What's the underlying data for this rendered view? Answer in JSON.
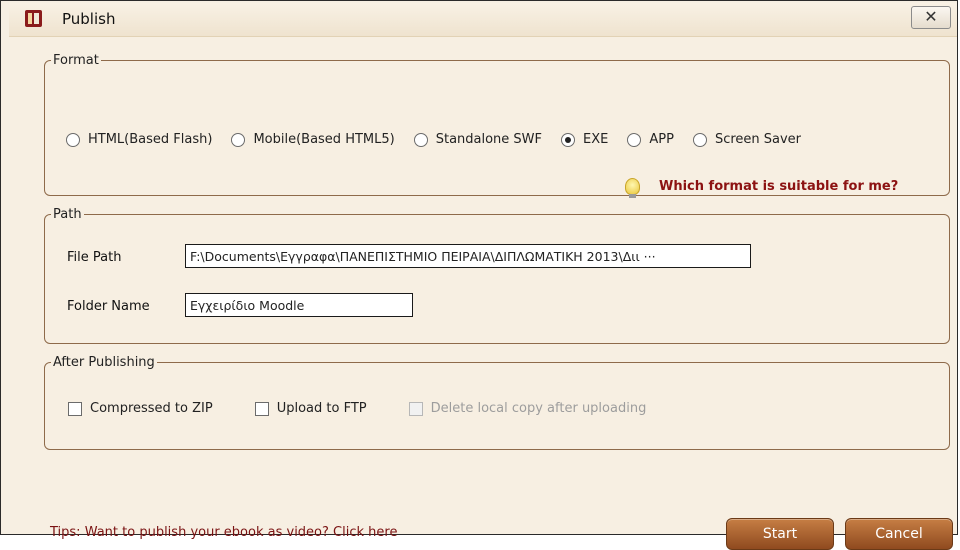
{
  "window": {
    "title": "Publish",
    "close_label": "✕"
  },
  "format": {
    "legend": "Format",
    "options": [
      {
        "label": "HTML(Based Flash)",
        "selected": false
      },
      {
        "label": "Mobile(Based HTML5)",
        "selected": false
      },
      {
        "label": "Standalone SWF",
        "selected": false
      },
      {
        "label": "EXE",
        "selected": true
      },
      {
        "label": "APP",
        "selected": false
      },
      {
        "label": "Screen Saver",
        "selected": false
      }
    ],
    "help_link": "Which format is suitable for me?"
  },
  "path": {
    "legend": "Path",
    "file_path_label": "File Path",
    "file_path_value": "F:\\Documents\\Εγγραφα\\ΠΑΝΕΠΙΣΤΗΜΙΟ ΠΕΙΡΑΙΑ\\ΔΙΠΛΩΜΑΤΙΚΗ 2013\\Διι ···",
    "folder_name_label": "Folder Name",
    "folder_name_value": "Εγχειρίδιο Moodle"
  },
  "after_publishing": {
    "legend": "After Publishing",
    "options": [
      {
        "label": "Compressed to ZIP",
        "checked": false,
        "disabled": false
      },
      {
        "label": "Upload to FTP",
        "checked": false,
        "disabled": false
      },
      {
        "label": "Delete local copy after uploading",
        "checked": false,
        "disabled": true
      }
    ]
  },
  "footer": {
    "tips": "Tips: Want to publish your ebook as video? Click here",
    "start_label": "Start",
    "cancel_label": "Cancel"
  },
  "colors": {
    "accent": "#8c1212",
    "button": "#b06a35",
    "border": "#8e6a4a"
  }
}
